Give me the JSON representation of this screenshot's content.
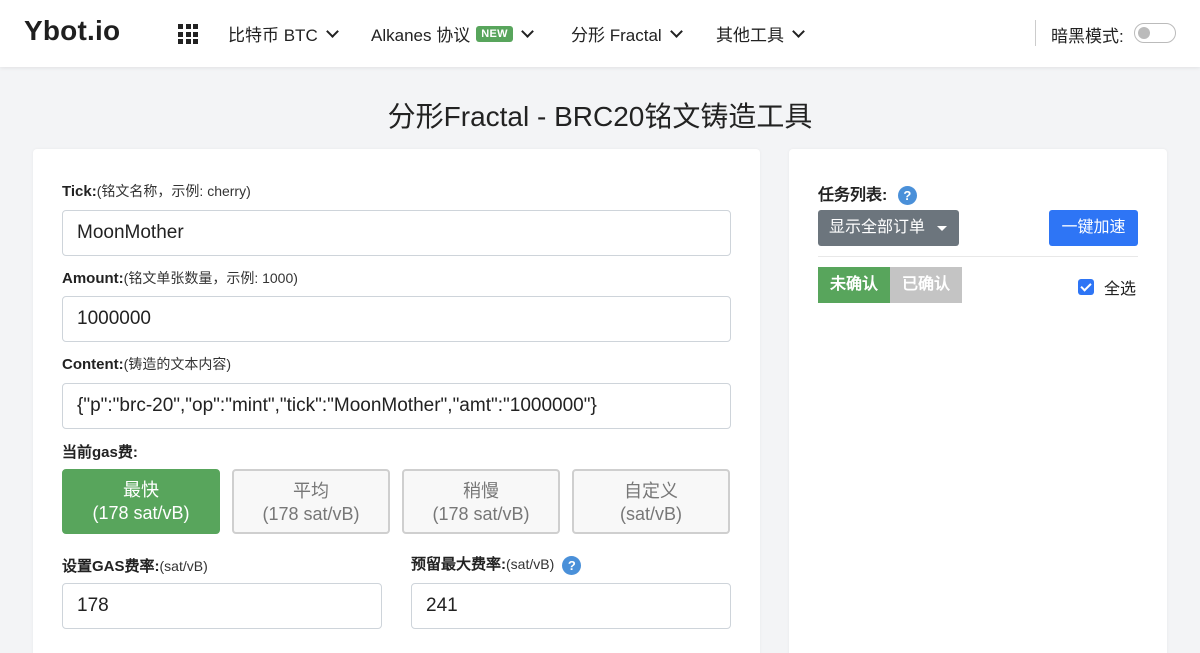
{
  "navbar": {
    "brand": "Ybot.io",
    "items": [
      {
        "label": "比特币 BTC"
      },
      {
        "label": "Alkanes 协议",
        "badge": "NEW"
      },
      {
        "label": "分形 Fractal"
      },
      {
        "label": "其他工具"
      }
    ],
    "dark_mode_label": "暗黑模式:",
    "dark_mode_on": false
  },
  "page": {
    "title": "分形Fractal - BRC20铭文铸造工具"
  },
  "form": {
    "tick": {
      "label": "Tick:",
      "hint": "(铭文名称，示例: cherry)",
      "value": "MoonMother"
    },
    "amount": {
      "label": "Amount:",
      "hint": "(铭文单张数量，示例: 1000)",
      "value": "1000000"
    },
    "content": {
      "label": "Content:",
      "hint": "(铸造的文本内容)",
      "value": "{\"p\":\"brc-20\",\"op\":\"mint\",\"tick\":\"MoonMother\",\"amt\":\"1000000\"}"
    },
    "gas_label": "当前gas费:",
    "gas_options": [
      {
        "name": "最快",
        "rate": "(178 sat/vB)",
        "active": true
      },
      {
        "name": "平均",
        "rate": "(178 sat/vB)",
        "active": false
      },
      {
        "name": "稍慢",
        "rate": "(178 sat/vB)",
        "active": false
      },
      {
        "name": "自定义",
        "rate": "(sat/vB)",
        "active": false
      }
    ],
    "gas_rate": {
      "label": "设置GAS费率:",
      "hint": "(sat/vB)",
      "value": "178"
    },
    "max_rate": {
      "label": "预留最大费率:",
      "hint": "(sat/vB)",
      "value": "241"
    }
  },
  "tasks": {
    "title": "任务列表:",
    "dropdown_label": "显示全部订单",
    "speed_up_label": "一键加速",
    "tabs": [
      "未确认",
      "已确认"
    ],
    "select_all_label": "全选",
    "select_all_checked": true
  },
  "icons": {
    "help": "?"
  },
  "colors": {
    "green": "#58a55c",
    "blue": "#2e75f5",
    "gray": "#6c757d",
    "help_blue": "#4a90d9"
  }
}
